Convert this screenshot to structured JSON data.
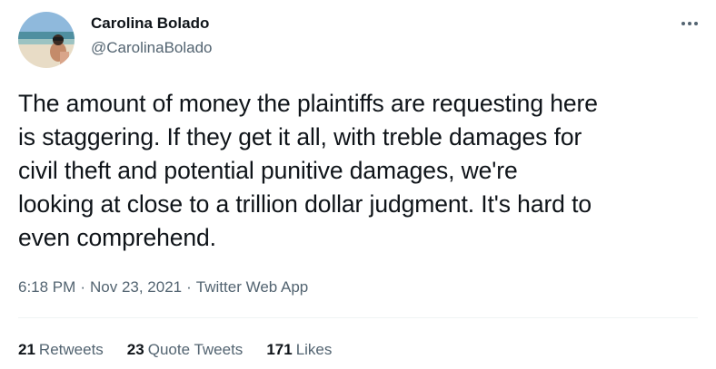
{
  "user": {
    "display_name": "Carolina Bolado",
    "handle": "@CarolinaBolado"
  },
  "tweet": {
    "lines": [
      "The amount of money the plaintiffs are requesting here",
      "is staggering. If they get it all, with treble damages for",
      "civil theft and potential punitive damages, we're",
      "looking at close to a trillion dollar judgment. It's hard to",
      "even comprehend."
    ],
    "time": "6:18 PM",
    "date": "Nov 23, 2021",
    "separator": "·",
    "source": "Twitter Web App"
  },
  "stats": {
    "retweets": {
      "count": "21",
      "label": "Retweets"
    },
    "quote_tweets": {
      "count": "23",
      "label": "Quote Tweets"
    },
    "likes": {
      "count": "171",
      "label": "Likes"
    }
  },
  "icons": {
    "more": "more-horizontal-icon"
  },
  "colors": {
    "text_primary": "#0f1419",
    "text_secondary": "#536471",
    "divider": "#eff3f4"
  }
}
